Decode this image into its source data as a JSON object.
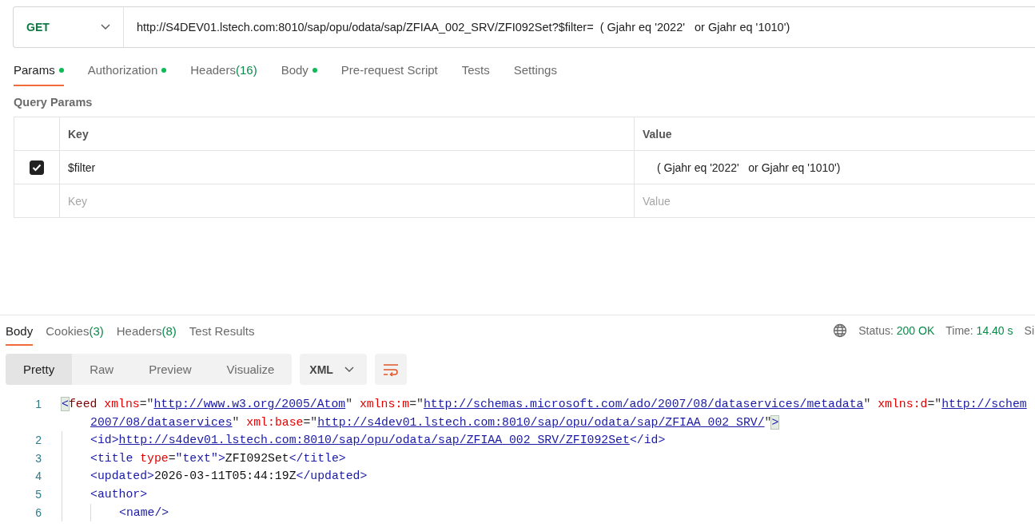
{
  "request": {
    "method": "GET",
    "url": "http://S4DEV01.lstech.com:8010/sap/opu/odata/sap/ZFIAA_002_SRV/ZFI092Set?$filter=  ( Gjahr eq '2022'   or Gjahr eq '1010')"
  },
  "request_tabs": [
    {
      "label": "Params",
      "dot": true,
      "selected": true
    },
    {
      "label": "Authorization",
      "dot": true,
      "selected": false
    },
    {
      "label": "Headers",
      "count": "(16)",
      "dot": false,
      "selected": false
    },
    {
      "label": "Body",
      "dot": true,
      "selected": false
    },
    {
      "label": "Pre-request Script",
      "dot": false,
      "selected": false
    },
    {
      "label": "Tests",
      "dot": false,
      "selected": false
    },
    {
      "label": "Settings",
      "dot": false,
      "selected": false
    }
  ],
  "query_params": {
    "title": "Query Params",
    "columns": [
      "Key",
      "Value"
    ],
    "rows": [
      {
        "checked": true,
        "key": "$filter",
        "value": "( Gjahr eq '2022'   or Gjahr eq '1010')"
      }
    ],
    "new_row": {
      "key_placeholder": "Key",
      "value_placeholder": "Value"
    }
  },
  "response_tabs": [
    {
      "label": "Body",
      "selected": true
    },
    {
      "label": "Cookies",
      "count": "(3)",
      "selected": false
    },
    {
      "label": "Headers",
      "count": "(8)",
      "selected": false
    },
    {
      "label": "Test Results",
      "selected": false
    }
  ],
  "response_meta": {
    "status_label": "Status:",
    "status": "200 OK",
    "time_label": "Time:",
    "time": "14.40 s",
    "cut_label": "Si"
  },
  "view_modes": [
    {
      "label": "Pretty",
      "selected": true
    },
    {
      "label": "Raw",
      "selected": false
    },
    {
      "label": "Preview",
      "selected": false
    },
    {
      "label": "Visualize",
      "selected": false
    }
  ],
  "format": "XML",
  "code_lines": [
    {
      "number": "1",
      "tokens": [
        {
          "kind": "match",
          "text": "<"
        },
        {
          "kind": "root",
          "text": "feed "
        },
        {
          "kind": "attr",
          "text": "xmlns"
        },
        {
          "kind": "punct",
          "text": "=\""
        },
        {
          "kind": "link",
          "text": "http://www.w3.org/2005/Atom"
        },
        {
          "kind": "punct",
          "text": "\" "
        },
        {
          "kind": "attr",
          "text": "xmlns:m"
        },
        {
          "kind": "punct",
          "text": "=\""
        },
        {
          "kind": "link",
          "text": "http://schemas.microsoft.com/ado/2007/08/dataservices/metadata"
        },
        {
          "kind": "punct",
          "text": "\" "
        },
        {
          "kind": "attr",
          "text": "xmlns:d"
        },
        {
          "kind": "punct",
          "text": "=\""
        },
        {
          "kind": "link",
          "text": "http://schem"
        }
      ],
      "wrapped": {
        "tokens": [
          {
            "kind": "link",
            "text": "2007/08/dataservices"
          },
          {
            "kind": "punct",
            "text": "\" "
          },
          {
            "kind": "attr",
            "text": "xml:base"
          },
          {
            "kind": "punct",
            "text": "=\""
          },
          {
            "kind": "link",
            "text": "http://s4dev01.lstech.com:8010/sap/opu/odata/sap/ZFIAA_002_SRV/"
          },
          {
            "kind": "punct",
            "text": "\""
          },
          {
            "kind": "match",
            "text": ">"
          }
        ]
      },
      "children": [
        {
          "number": "2",
          "tokens": [
            {
              "kind": "tag",
              "text": "<id>"
            },
            {
              "kind": "link",
              "text": "http://s4dev01.lstech.com:8010/sap/opu/odata/sap/ZFIAA_002_SRV/ZFI092Set"
            },
            {
              "kind": "tag",
              "text": "</id>"
            }
          ]
        },
        {
          "number": "3",
          "tokens": [
            {
              "kind": "tag",
              "text": "<title "
            },
            {
              "kind": "attr",
              "text": "type"
            },
            {
              "kind": "punct",
              "text": "="
            },
            {
              "kind": "string",
              "text": "\"text\""
            },
            {
              "kind": "tag",
              "text": ">"
            },
            {
              "kind": "text",
              "text": "ZFI092Set"
            },
            {
              "kind": "tag",
              "text": "</title>"
            }
          ]
        },
        {
          "number": "4",
          "tokens": [
            {
              "kind": "tag",
              "text": "<updated>"
            },
            {
              "kind": "text",
              "text": "2026-03-11T05:44:19Z"
            },
            {
              "kind": "tag",
              "text": "</updated>"
            }
          ]
        },
        {
          "number": "5",
          "tokens": [
            {
              "kind": "tag",
              "text": "<author>"
            }
          ],
          "children": [
            {
              "number": "6",
              "tokens": [
                {
                  "kind": "tag",
                  "text": "<name/>"
                }
              ]
            }
          ]
        }
      ]
    }
  ]
}
